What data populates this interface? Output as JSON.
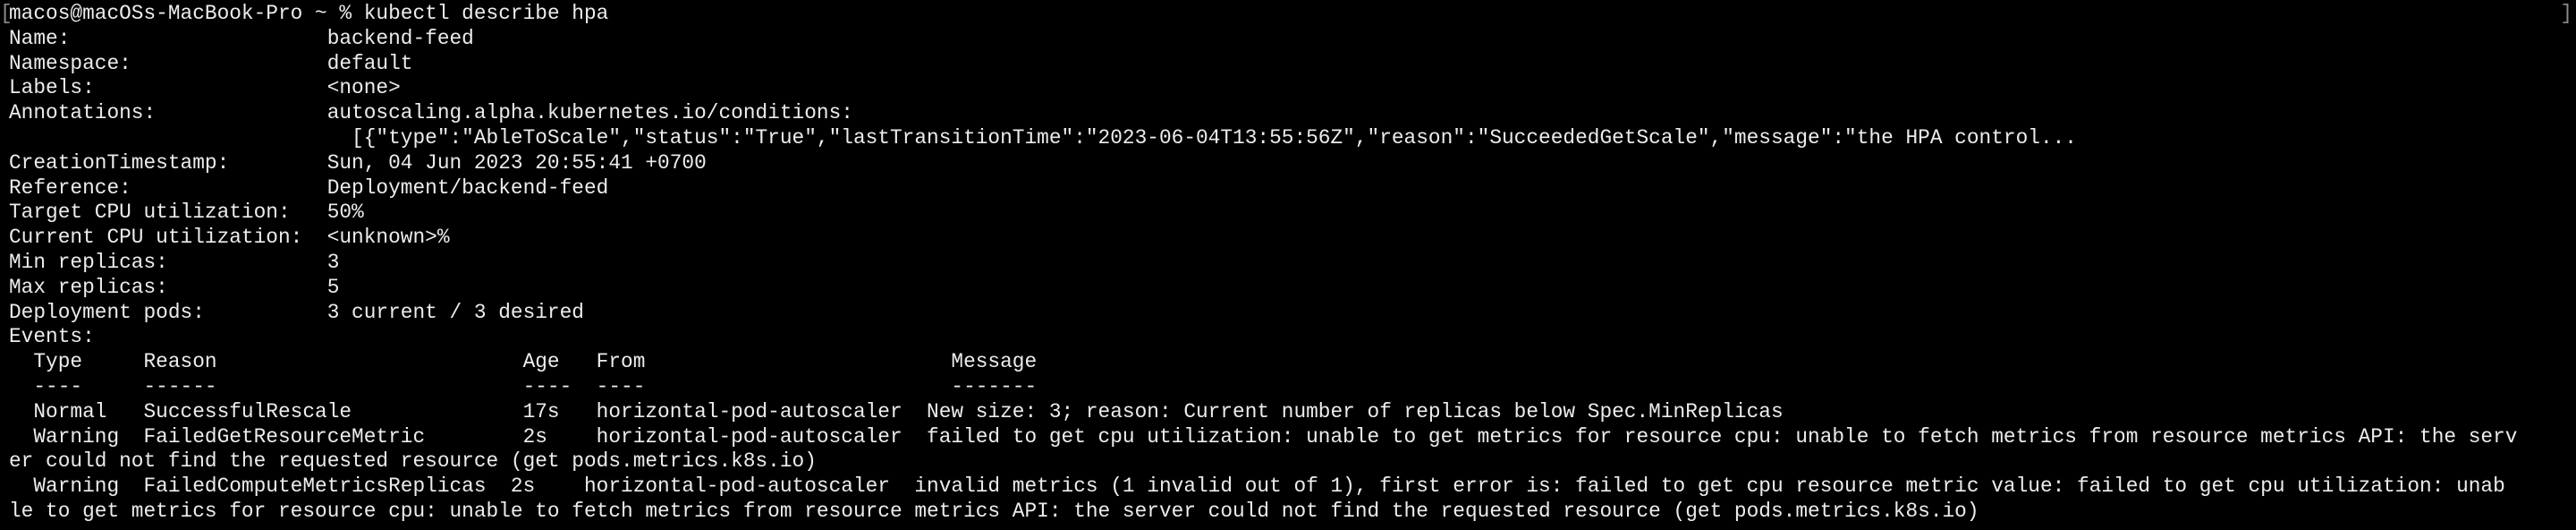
{
  "terminal": {
    "prompt": "macos@macOSs-MacBook-Pro ~ % ",
    "command": "kubectl describe hpa",
    "bracket_left": "[",
    "bracket_right": "]",
    "lines": [
      "Name:                     backend-feed",
      "Namespace:                default",
      "Labels:                   <none>",
      "Annotations:              autoscaling.alpha.kubernetes.io/conditions:",
      "                            [{\"type\":\"AbleToScale\",\"status\":\"True\",\"lastTransitionTime\":\"2023-06-04T13:55:56Z\",\"reason\":\"SucceededGetScale\",\"message\":\"the HPA control...",
      "CreationTimestamp:        Sun, 04 Jun 2023 20:55:41 +0700",
      "Reference:                Deployment/backend-feed",
      "Target CPU utilization:   50%",
      "Current CPU utilization:  <unknown>%",
      "Min replicas:             3",
      "Max replicas:             5",
      "Deployment pods:          3 current / 3 desired",
      "Events:",
      "  Type     Reason                         Age   From                         Message",
      "  ----     ------                         ----  ----                         -------",
      "  Normal   SuccessfulRescale              17s   horizontal-pod-autoscaler  New size: 3; reason: Current number of replicas below Spec.MinReplicas",
      "  Warning  FailedGetResourceMetric        2s    horizontal-pod-autoscaler  failed to get cpu utilization: unable to get metrics for resource cpu: unable to fetch metrics from resource metrics API: the serv",
      "er could not find the requested resource (get pods.metrics.k8s.io)",
      "  Warning  FailedComputeMetricsReplicas  2s    horizontal-pod-autoscaler  invalid metrics (1 invalid out of 1), first error is: failed to get cpu resource metric value: failed to get cpu utilization: unab",
      "le to get metrics for resource cpu: unable to fetch metrics from resource metrics API: the server could not find the requested resource (get pods.metrics.k8s.io)"
    ]
  }
}
